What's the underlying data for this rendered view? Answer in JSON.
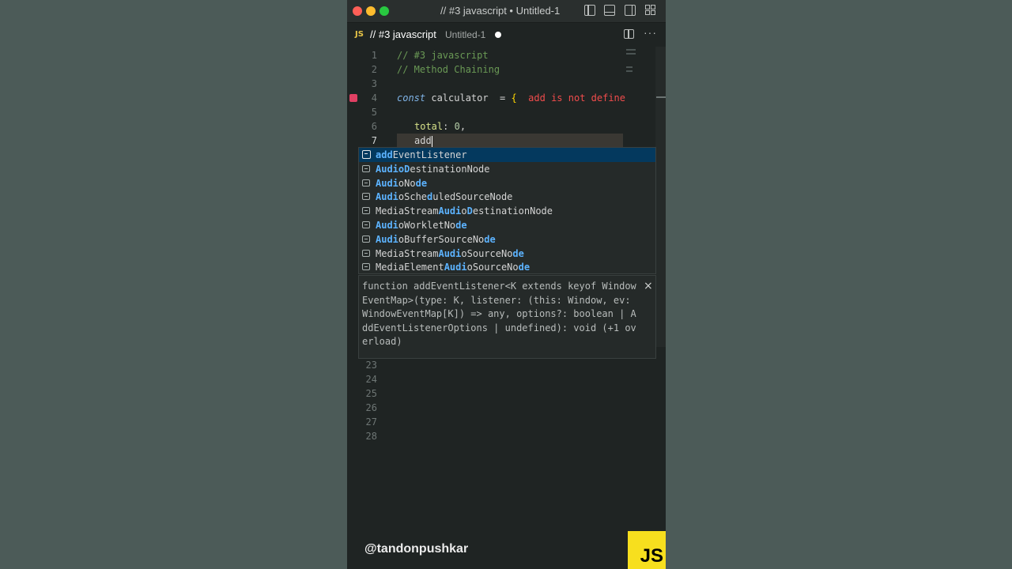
{
  "window": {
    "title": "// #3 javascript • Untitled-1"
  },
  "tab": {
    "lang_icon": "JS",
    "name": "// #3 javascript",
    "file": "Untitled-1"
  },
  "editor": {
    "lines": [
      {
        "num": "1",
        "text": "// #3 javascript"
      },
      {
        "num": "2",
        "text": "// Method Chaining"
      },
      {
        "num": "3",
        "text": ""
      },
      {
        "num": "4",
        "keyword": "const",
        "ident": " calculator  = ",
        "brace": "{",
        "error": "  add is not define"
      },
      {
        "num": "5",
        "text": ""
      },
      {
        "num": "6",
        "prop": "total",
        "rest": ": ",
        "number": "0",
        "end": ","
      },
      {
        "num": "7",
        "text": "add"
      },
      {
        "num": "23"
      },
      {
        "num": "24"
      },
      {
        "num": "25"
      },
      {
        "num": "26"
      },
      {
        "num": "27"
      },
      {
        "num": "28"
      }
    ]
  },
  "suggestions": [
    {
      "segments": [
        [
          "add",
          "m"
        ],
        [
          "EventListener",
          ""
        ]
      ]
    },
    {
      "segments": [
        [
          "Audio",
          "m"
        ],
        [
          "D",
          "m"
        ],
        [
          "estinationNode",
          ""
        ]
      ]
    },
    {
      "segments": [
        [
          "Audi",
          "m"
        ],
        [
          "oNo",
          ""
        ],
        [
          "d",
          "m"
        ],
        [
          "e",
          "m"
        ]
      ]
    },
    {
      "segments": [
        [
          "Audi",
          "m"
        ],
        [
          "oSche",
          ""
        ],
        [
          "d",
          "m"
        ],
        [
          "uledSourceNode",
          ""
        ]
      ]
    },
    {
      "segments": [
        [
          "MediaStream",
          ""
        ],
        [
          "Audi",
          "m"
        ],
        [
          "o",
          ""
        ],
        [
          "D",
          "m"
        ],
        [
          "estinationNode",
          ""
        ]
      ]
    },
    {
      "segments": [
        [
          "Audi",
          "m"
        ],
        [
          "oWorkletNo",
          ""
        ],
        [
          "d",
          "m"
        ],
        [
          "e",
          "m"
        ]
      ]
    },
    {
      "segments": [
        [
          "Audi",
          "m"
        ],
        [
          "oBufferSourceNo",
          ""
        ],
        [
          "d",
          "m"
        ],
        [
          "e",
          "m"
        ]
      ]
    },
    {
      "segments": [
        [
          "MediaStream",
          ""
        ],
        [
          "Audi",
          "m"
        ],
        [
          "oSourceNo",
          ""
        ],
        [
          "d",
          "m"
        ],
        [
          "e",
          "m"
        ]
      ]
    },
    {
      "segments": [
        [
          "MediaElement",
          ""
        ],
        [
          "Audi",
          "m"
        ],
        [
          "oSourceNo",
          ""
        ],
        [
          "d",
          "m"
        ],
        [
          "e",
          "m"
        ]
      ]
    }
  ],
  "doc": {
    "lines": [
      "function addEventListener<K extends keyof Window",
      "EventMap>(type: K, listener: (this: Window, ev:",
      "WindowEventMap[K]) => any, options?: boolean | A",
      "ddEventListenerOptions | undefined): void (+1 ov",
      "erload)"
    ],
    "close": "×"
  },
  "overlay": {
    "handle": "@tandonpushkar",
    "badge": "JS"
  },
  "colors": {
    "selection": "#04395e",
    "match": "#5cb3ff",
    "breakpoint": "#e04063",
    "js_yellow": "#f7df1e"
  }
}
